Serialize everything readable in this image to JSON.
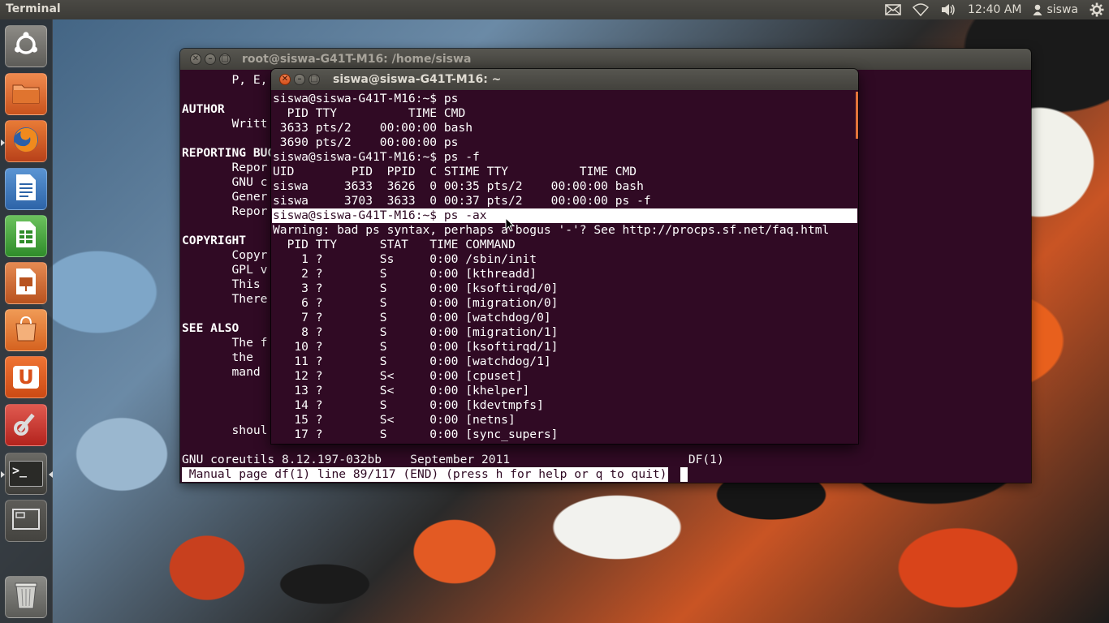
{
  "top_panel": {
    "app_title": "Terminal",
    "clock": "12:40 AM",
    "user": "siswa",
    "indicators": [
      "mail-icon",
      "wifi-icon",
      "volume-icon",
      "user-icon",
      "gear-icon"
    ]
  },
  "launcher": {
    "items": [
      {
        "name": "dash-home",
        "icon": "ubuntu-logo-icon",
        "color": "#7a7a78"
      },
      {
        "name": "files",
        "icon": "folder-icon",
        "color": "#e0642a"
      },
      {
        "name": "firefox",
        "icon": "firefox-icon",
        "color": "#d95a1c"
      },
      {
        "name": "writer",
        "icon": "writer-document-icon",
        "color": "#3573b8"
      },
      {
        "name": "calc",
        "icon": "calc-spreadsheet-icon",
        "color": "#3d9b35"
      },
      {
        "name": "impress",
        "icon": "impress-presentation-icon",
        "color": "#c9642a"
      },
      {
        "name": "software-center",
        "icon": "shopping-bag-icon",
        "color": "#e7702c"
      },
      {
        "name": "ubuntu-one",
        "icon": "ubuntu-one-icon",
        "glyph": "U",
        "color": "#e25a1c"
      },
      {
        "name": "system-settings",
        "icon": "settings-tools-icon",
        "color": "#d2352c"
      },
      {
        "name": "terminal",
        "icon": "terminal-icon",
        "glyph": ">_",
        "color": "#3a3a36"
      },
      {
        "name": "workspace-switcher",
        "icon": "workspace-switcher-icon",
        "color": "#555"
      },
      {
        "name": "trash",
        "icon": "trash-icon",
        "color": "#6f6f6f"
      }
    ]
  },
  "back_window": {
    "title": "root@siswa-G41T-M16: /home/siswa",
    "lines": [
      "       P, E,",
      "",
      "AUTHOR",
      "       Writt",
      "",
      "REPORTING BUG",
      "       Repor",
      "       GNU c",
      "       Gener",
      "       Repor",
      "",
      "COPYRIGHT",
      "       Copyr",
      "       GPL v",
      "       This",
      "       There",
      "",
      "SEE ALSO",
      "       The f",
      "       the  ",
      "       mand",
      "",
      "",
      "",
      "       shoul"
    ],
    "footer": "GNU coreutils 8.12.197-032bb    September 2011                         DF(1)",
    "status": " Manual page df(1) line 89/117 (END) (press h for help or q to quit)"
  },
  "front_window": {
    "title": "siswa@siswa-G41T-M16: ~",
    "lines": [
      "siswa@siswa-G41T-M16:~$ ps",
      "  PID TTY          TIME CMD",
      " 3633 pts/2    00:00:00 bash",
      " 3690 pts/2    00:00:00 ps",
      "siswa@siswa-G41T-M16:~$ ps -f",
      "UID        PID  PPID  C STIME TTY          TIME CMD",
      "siswa     3633  3626  0 00:35 pts/2    00:00:00 bash",
      "siswa     3703  3633  0 00:37 pts/2    00:00:00 ps -f",
      "siswa@siswa-G41T-M16:~$ ps -ax",
      "Warning: bad ps syntax, perhaps a bogus '-'? See http://procps.sf.net/faq.html",
      "  PID TTY      STAT   TIME COMMAND",
      "    1 ?        Ss     0:00 /sbin/init",
      "    2 ?        S      0:00 [kthreadd]",
      "    3 ?        S      0:00 [ksoftirqd/0]",
      "    6 ?        S      0:00 [migration/0]",
      "    7 ?        S      0:00 [watchdog/0]",
      "    8 ?        S      0:00 [migration/1]",
      "   10 ?        S      0:00 [ksoftirqd/1]",
      "   11 ?        S      0:00 [watchdog/1]",
      "   12 ?        S<     0:00 [cpuset]",
      "   13 ?        S<     0:00 [khelper]",
      "   14 ?        S      0:00 [kdevtmpfs]",
      "   15 ?        S<     0:00 [netns]",
      "   17 ?        S      0:00 [sync_supers]"
    ],
    "selected_line_index": 8
  }
}
